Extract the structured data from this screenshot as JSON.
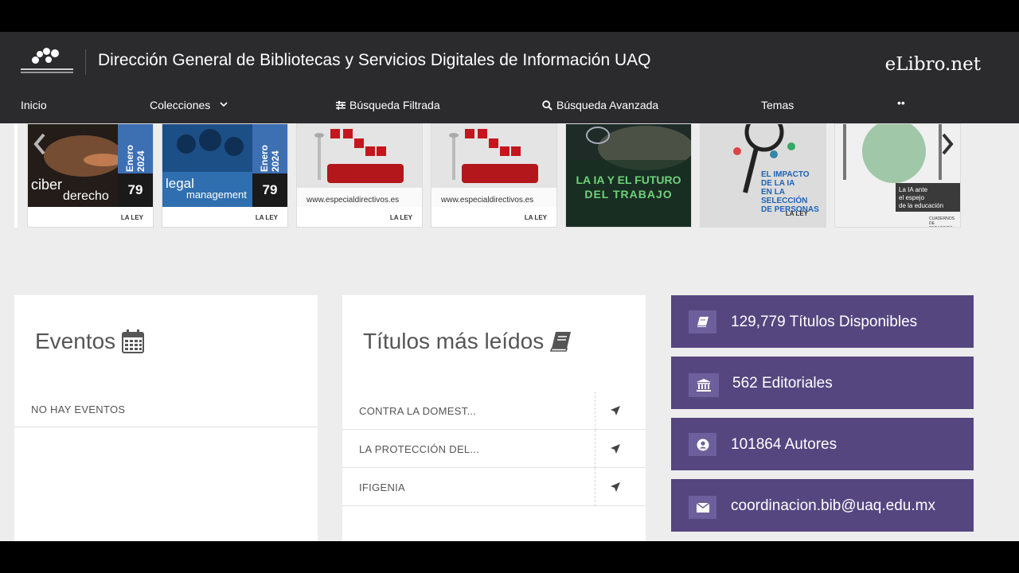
{
  "header": {
    "title": "Dirección General de Bibliotecas y Servicios Digitales de Información UAQ",
    "brand": "eLibro.net"
  },
  "nav": {
    "inicio": "Inicio",
    "colecciones": "Colecciones",
    "busqueda_filtrada": "Búsqueda Filtrada",
    "busqueda_avanzada": "Búsqueda Avanzada",
    "temas": "Temas",
    "more": "••"
  },
  "carousel": {
    "books": [
      {
        "title_line1": "ciber",
        "title_line2": "derecho",
        "month": "Enero 2024",
        "number": "79",
        "publisher": "LA LEY"
      },
      {
        "title_line1": "legal",
        "title_line2": "management",
        "month": "Enero 2024",
        "number": "79",
        "publisher": "LA LEY"
      },
      {
        "caption": "www.especialdirectivos.es",
        "publisher": "LA LEY"
      },
      {
        "caption": "www.especialdirectivos.es",
        "publisher": "LA LEY"
      },
      {
        "line1": "LA IA Y EL FUTURO",
        "line2": "DEL TRABAJO"
      },
      {
        "line1": "EL IMPACTO",
        "line2": "DE LA IA",
        "line3": "EN LA SELECCIÓN",
        "line4": "DE PERSONAS",
        "publisher": "LA LEY"
      },
      {
        "line1": "La IA ante",
        "line2": "el espejo",
        "line3": "de la educación",
        "publisher": "CUADERNOS DE PEDAGOGÍA"
      }
    ]
  },
  "eventos": {
    "title": "Eventos",
    "empty": "NO HAY EVENTOS"
  },
  "titulos": {
    "title": "Títulos más leídos",
    "items": [
      "CONTRA LA DOMEST...",
      "LA PROTECCIÓN DEL...",
      "IFIGENIA"
    ]
  },
  "stats": {
    "titulos": "129,779 Títulos Disponibles",
    "editoriales": "562 Editoriales",
    "autores": "101864 Autores",
    "email": "coordinacion.bib@uaq.edu.mx"
  },
  "colors": {
    "header_bg": "#2b2b2e",
    "stat_bg": "#554680",
    "page_bg": "#ededed"
  }
}
